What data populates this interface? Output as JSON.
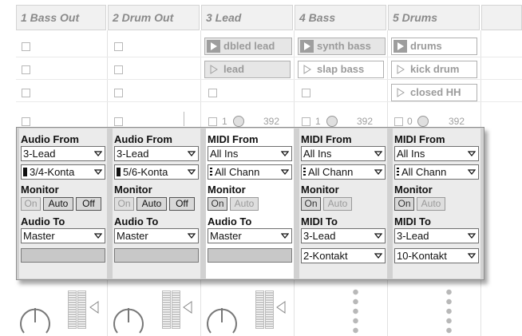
{
  "tracks": [
    {
      "name": "1 Bass Out"
    },
    {
      "name": "2 Drum Out"
    },
    {
      "name": "3 Lead"
    },
    {
      "name": "4 Bass"
    },
    {
      "name": "5 Drums"
    }
  ],
  "clips": {
    "lead_1": "dbled lead",
    "lead_2": "lead",
    "bass_1": "synth bass",
    "bass_2": "slap bass",
    "drums_1": "drums",
    "drums_2": "kick drum",
    "drums_3": "closed HH"
  },
  "track_numbers": {
    "lead": {
      "n": "1",
      "v": "392"
    },
    "bass": {
      "n": "1",
      "v": "392"
    },
    "drums": {
      "n": "0",
      "v": "392"
    }
  },
  "io": [
    {
      "from_label": "Audio From",
      "from_value": "3-Lead",
      "chan_value": "3/4-Konta",
      "monitor_label": "Monitor",
      "mon_in": "On",
      "mon_auto": "Auto",
      "mon_off": "Off",
      "to_label": "Audio To",
      "to_value": "Master"
    },
    {
      "from_label": "Audio From",
      "from_value": "3-Lead",
      "chan_value": "5/6-Konta",
      "monitor_label": "Monitor",
      "mon_in": "On",
      "mon_auto": "Auto",
      "mon_off": "Off",
      "to_label": "Audio To",
      "to_value": "Master"
    },
    {
      "from_label": "MIDI From",
      "from_value": "All Ins",
      "chan_value": "All Chann",
      "monitor_label": "Monitor",
      "mon_in": "On",
      "mon_auto": "Auto",
      "to_label": "Audio To",
      "to_value": "Master"
    },
    {
      "from_label": "MIDI From",
      "from_value": "All Ins",
      "chan_value": "All Chann",
      "monitor_label": "Monitor",
      "mon_in": "On",
      "mon_auto": "Auto",
      "to_label": "MIDI To",
      "to_value": "3-Lead",
      "to_chan_value": "2-Kontakt"
    },
    {
      "from_label": "MIDI From",
      "from_value": "All Ins",
      "chan_value": "All Chann",
      "monitor_label": "Monitor",
      "mon_in": "On",
      "mon_auto": "Auto",
      "to_label": "MIDI To",
      "to_value": "3-Lead",
      "to_chan_value": "10-Kontakt"
    }
  ],
  "colors": {
    "play_filled": "#9e9e9e",
    "panel_bg": "#d1d1d1",
    "col_bg": "#ebebeb",
    "meter_fill": "#8a8a8a"
  },
  "icons": [
    "play-icon",
    "dropdown-arrow-icon",
    "knob-icon",
    "volume-meter-icon",
    "arm-indicator-icon",
    "channel-chip-icon"
  ]
}
